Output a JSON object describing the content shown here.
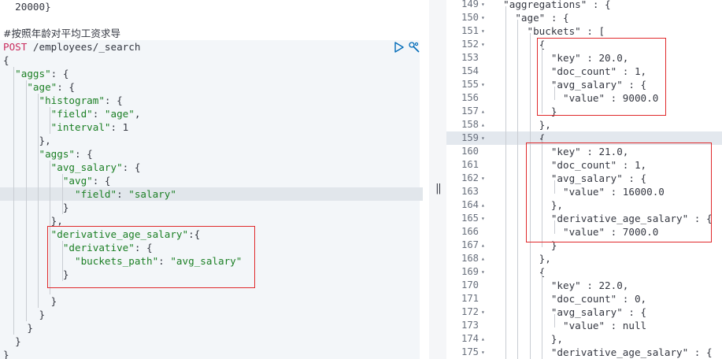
{
  "left_editor": {
    "lines": [
      {
        "parts": [
          {
            "t": "  20000}",
            "c": "k"
          }
        ]
      },
      {
        "parts": [
          {
            "t": "",
            "c": "k"
          }
        ]
      },
      {
        "parts": [
          {
            "t": "#按照年龄对平均工资求导",
            "c": "comment"
          }
        ]
      },
      {
        "parts": [
          {
            "t": "POST",
            "c": "method"
          },
          {
            "t": " /employees/_search",
            "c": "k"
          }
        ]
      },
      {
        "parts": [
          {
            "t": "{",
            "c": "k"
          }
        ]
      },
      {
        "parts": [
          {
            "t": "  ",
            "c": "k"
          },
          {
            "t": "\"aggs\"",
            "c": "str"
          },
          {
            "t": ": {",
            "c": "k"
          }
        ]
      },
      {
        "parts": [
          {
            "t": "    ",
            "c": "k"
          },
          {
            "t": "\"age\"",
            "c": "str"
          },
          {
            "t": ": {",
            "c": "k"
          }
        ]
      },
      {
        "parts": [
          {
            "t": "      ",
            "c": "k"
          },
          {
            "t": "\"histogram\"",
            "c": "str"
          },
          {
            "t": ": {",
            "c": "k"
          }
        ]
      },
      {
        "parts": [
          {
            "t": "        ",
            "c": "k"
          },
          {
            "t": "\"field\"",
            "c": "str"
          },
          {
            "t": ": ",
            "c": "k"
          },
          {
            "t": "\"age\"",
            "c": "str"
          },
          {
            "t": ",",
            "c": "k"
          }
        ]
      },
      {
        "parts": [
          {
            "t": "        ",
            "c": "k"
          },
          {
            "t": "\"interval\"",
            "c": "str"
          },
          {
            "t": ": 1",
            "c": "k"
          }
        ]
      },
      {
        "parts": [
          {
            "t": "      },",
            "c": "k"
          }
        ]
      },
      {
        "parts": [
          {
            "t": "      ",
            "c": "k"
          },
          {
            "t": "\"aggs\"",
            "c": "str"
          },
          {
            "t": ": {",
            "c": "k"
          }
        ]
      },
      {
        "parts": [
          {
            "t": "        ",
            "c": "k"
          },
          {
            "t": "\"avg_salary\"",
            "c": "str"
          },
          {
            "t": ": {",
            "c": "k"
          }
        ]
      },
      {
        "parts": [
          {
            "t": "          ",
            "c": "k"
          },
          {
            "t": "\"avg\"",
            "c": "str"
          },
          {
            "t": ": {",
            "c": "k"
          }
        ]
      },
      {
        "parts": [
          {
            "t": "            ",
            "c": "k"
          },
          {
            "t": "\"field\"",
            "c": "str"
          },
          {
            "t": ": ",
            "c": "k"
          },
          {
            "t": "\"salary\"",
            "c": "str"
          }
        ]
      },
      {
        "parts": [
          {
            "t": "          }",
            "c": "k"
          }
        ]
      },
      {
        "parts": [
          {
            "t": "        },",
            "c": "k"
          }
        ]
      },
      {
        "parts": [
          {
            "t": "        ",
            "c": "k"
          },
          {
            "t": "\"derivative_age_salary\"",
            "c": "str"
          },
          {
            "t": ":{",
            "c": "k"
          }
        ]
      },
      {
        "parts": [
          {
            "t": "          ",
            "c": "k"
          },
          {
            "t": "\"derivative\"",
            "c": "str"
          },
          {
            "t": ": {",
            "c": "k"
          }
        ]
      },
      {
        "parts": [
          {
            "t": "            ",
            "c": "k"
          },
          {
            "t": "\"buckets_path\"",
            "c": "str"
          },
          {
            "t": ": ",
            "c": "k"
          },
          {
            "t": "\"avg_salary\"",
            "c": "str"
          }
        ]
      },
      {
        "parts": [
          {
            "t": "          }",
            "c": "k"
          }
        ]
      },
      {
        "parts": [
          {
            "t": "",
            "c": "k"
          }
        ]
      },
      {
        "parts": [
          {
            "t": "        }",
            "c": "k"
          }
        ]
      },
      {
        "parts": [
          {
            "t": "      }",
            "c": "k"
          }
        ]
      },
      {
        "parts": [
          {
            "t": "    }",
            "c": "k"
          }
        ]
      },
      {
        "parts": [
          {
            "t": "  }",
            "c": "k"
          }
        ]
      },
      {
        "parts": [
          {
            "t": "}",
            "c": "k"
          }
        ]
      }
    ],
    "highlighted_line": 14
  },
  "right_editor": {
    "lines": [
      {
        "n": "149",
        "fold": "▾",
        "parts": [
          {
            "t": "  \"aggregations\" : {",
            "c": "k"
          }
        ]
      },
      {
        "n": "150",
        "fold": "▾",
        "parts": [
          {
            "t": "    \"age\" : {",
            "c": "k"
          }
        ]
      },
      {
        "n": "151",
        "fold": "▾",
        "parts": [
          {
            "t": "      \"buckets\" : [",
            "c": "k"
          }
        ]
      },
      {
        "n": "152",
        "fold": "▾",
        "parts": [
          {
            "t": "        {",
            "c": "k"
          }
        ]
      },
      {
        "n": "153",
        "fold": "",
        "parts": [
          {
            "t": "          \"key\" : 20.0,",
            "c": "k"
          }
        ]
      },
      {
        "n": "154",
        "fold": "",
        "parts": [
          {
            "t": "          \"doc_count\" : 1,",
            "c": "k"
          }
        ]
      },
      {
        "n": "155",
        "fold": "▾",
        "parts": [
          {
            "t": "          \"avg_salary\" : {",
            "c": "k"
          }
        ]
      },
      {
        "n": "156",
        "fold": "",
        "parts": [
          {
            "t": "            \"value\" : 9000.0",
            "c": "k"
          }
        ]
      },
      {
        "n": "157",
        "fold": "▴",
        "parts": [
          {
            "t": "          }",
            "c": "k"
          }
        ]
      },
      {
        "n": "158",
        "fold": "▴",
        "parts": [
          {
            "t": "        },",
            "c": "k"
          }
        ]
      },
      {
        "n": "159",
        "fold": "▾",
        "parts": [
          {
            "t": "        {",
            "c": "k"
          }
        ]
      },
      {
        "n": "160",
        "fold": "",
        "parts": [
          {
            "t": "          \"key\" : 21.0,",
            "c": "k"
          }
        ]
      },
      {
        "n": "161",
        "fold": "",
        "parts": [
          {
            "t": "          \"doc_count\" : 1,",
            "c": "k"
          }
        ]
      },
      {
        "n": "162",
        "fold": "▾",
        "parts": [
          {
            "t": "          \"avg_salary\" : {",
            "c": "k"
          }
        ]
      },
      {
        "n": "163",
        "fold": "",
        "parts": [
          {
            "t": "            \"value\" : 16000.0",
            "c": "k"
          }
        ]
      },
      {
        "n": "164",
        "fold": "▴",
        "parts": [
          {
            "t": "          },",
            "c": "k"
          }
        ]
      },
      {
        "n": "165",
        "fold": "▾",
        "parts": [
          {
            "t": "          \"derivative_age_salary\" : {",
            "c": "k"
          }
        ]
      },
      {
        "n": "166",
        "fold": "",
        "parts": [
          {
            "t": "            \"value\" : 7000.0",
            "c": "k"
          }
        ]
      },
      {
        "n": "167",
        "fold": "▴",
        "parts": [
          {
            "t": "          }",
            "c": "k"
          }
        ]
      },
      {
        "n": "168",
        "fold": "▴",
        "parts": [
          {
            "t": "        },",
            "c": "k"
          }
        ]
      },
      {
        "n": "169",
        "fold": "▾",
        "parts": [
          {
            "t": "        {",
            "c": "k"
          }
        ]
      },
      {
        "n": "170",
        "fold": "",
        "parts": [
          {
            "t": "          \"key\" : 22.0,",
            "c": "k"
          }
        ]
      },
      {
        "n": "171",
        "fold": "",
        "parts": [
          {
            "t": "          \"doc_count\" : 0,",
            "c": "k"
          }
        ]
      },
      {
        "n": "172",
        "fold": "▾",
        "parts": [
          {
            "t": "          \"avg_salary\" : {",
            "c": "k"
          }
        ]
      },
      {
        "n": "173",
        "fold": "",
        "parts": [
          {
            "t": "            \"value\" : null",
            "c": "k"
          }
        ]
      },
      {
        "n": "174",
        "fold": "▴",
        "parts": [
          {
            "t": "          },",
            "c": "k"
          }
        ]
      },
      {
        "n": "175",
        "fold": "▾",
        "parts": [
          {
            "t": "          \"derivative_age_salary\" : {",
            "c": "k"
          }
        ]
      }
    ],
    "highlighted_line": 10
  },
  "icons": {
    "run": "play-icon",
    "settings": "wrench-icon",
    "divider": "resize-handle-icon"
  },
  "colors": {
    "string": "#1b7f24",
    "method": "#c92b5d",
    "annotation_box": "#e0292b",
    "request_bg": "#f3f6f9"
  }
}
